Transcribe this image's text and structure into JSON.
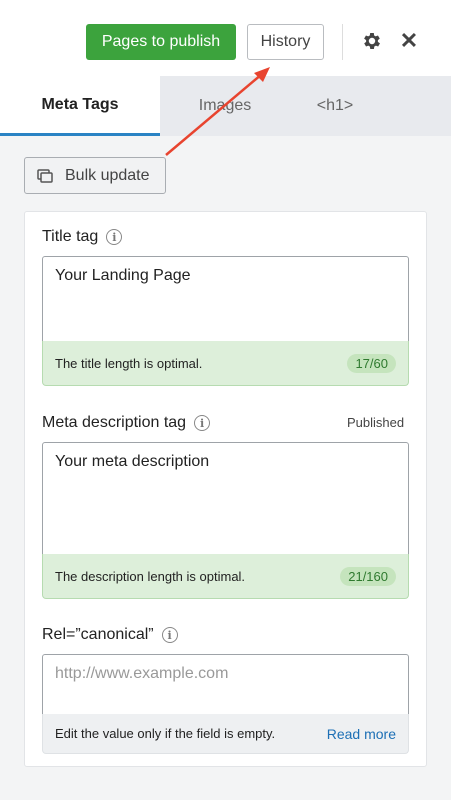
{
  "toolbar": {
    "publish_label": "Pages to publish",
    "history_label": "History",
    "settings_icon": "gear-icon",
    "close_icon": "close-icon",
    "close_glyph": "✕",
    "publish_color": "#3ca33d"
  },
  "tabs": [
    {
      "label": "Meta Tags",
      "active": true
    },
    {
      "label": "Images",
      "active": false
    },
    {
      "label": "<h1>",
      "active": false
    },
    {
      "label": "",
      "icon": "crosshair-icon",
      "active": false
    }
  ],
  "bulk_update": {
    "label": "Bulk update",
    "icon": "bulk-icon"
  },
  "title_tag": {
    "label": "Title tag",
    "value": "Your Landing Page",
    "helper": "The title length is optimal.",
    "count": "17/60"
  },
  "meta_description": {
    "label": "Meta description tag",
    "status": "Published",
    "value": "Your meta description",
    "helper": "The description length is optimal.",
    "count": "21/160"
  },
  "canonical": {
    "label": "Rel=”canonical”",
    "placeholder": "http://www.example.com",
    "helper": "Edit the value only if the field is empty.",
    "link": "Read more"
  },
  "colors": {
    "accent": "#2a83c4",
    "success_bg": "#ddefda",
    "annotation_arrow": "#e8442f"
  }
}
